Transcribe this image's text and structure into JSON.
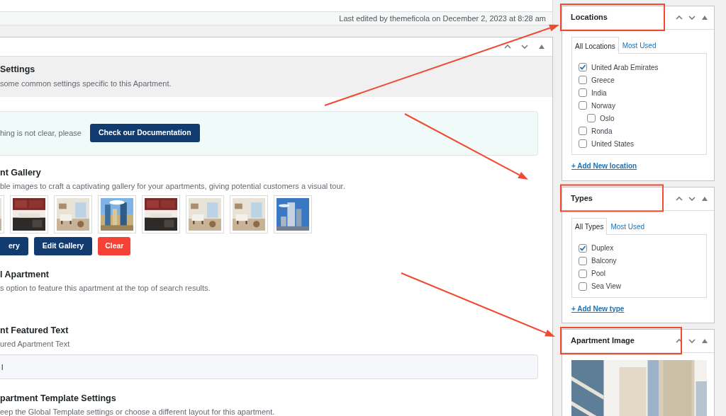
{
  "editor_status": {
    "last_edited": "Last edited by themeficola on December 2, 2023 at 8:28 am"
  },
  "settings_box": {
    "heading": "Settings",
    "description": "some common settings specific to this Apartment.",
    "notice": {
      "text": "hing is not clear, please",
      "button": "Check our Documentation"
    },
    "fields": [
      {
        "kind": "gallery",
        "label": "nt Gallery",
        "description": "ble images to craft a captivating gallery for your apartments, giving potential customers a visual tour.",
        "images": [
          {
            "kind": "picture"
          },
          {
            "kind": "picture"
          },
          {
            "kind": "picture"
          },
          {
            "kind": "picture"
          },
          {
            "kind": "picture"
          },
          {
            "kind": "picture"
          },
          {
            "kind": "picture"
          },
          {
            "kind": "picture"
          }
        ],
        "buttons": [
          {
            "label": "ery",
            "kind": "primary"
          },
          {
            "label": "Edit Gallery",
            "kind": "primary"
          },
          {
            "label": "Clear",
            "kind": "danger"
          }
        ]
      },
      {
        "kind": "option",
        "label": "l Apartment",
        "description": "s option to feature this apartment at the top of search results."
      },
      {
        "kind": "text",
        "label": "nt Featured Text",
        "description": "ured Apartment Text",
        "value": "l"
      },
      {
        "kind": "plain",
        "label": "partment Template Settings",
        "description": "eep the Global Template settings or choose a different layout for this apartment."
      }
    ]
  },
  "sidebar": [
    {
      "kind": "taxonomy",
      "title": "Locations",
      "tabs": [
        {
          "label": "All Locations",
          "selected": true
        },
        {
          "label": "Most Used",
          "selected": false
        }
      ],
      "terms": [
        {
          "label": "United Arab Emirates",
          "checked": true
        },
        {
          "label": "Greece",
          "checked": false
        },
        {
          "label": "India",
          "checked": false
        },
        {
          "label": "Norway",
          "checked": false,
          "children": [
            {
              "label": "Oslo",
              "checked": false
            }
          ]
        },
        {
          "label": "Ronda",
          "checked": false
        },
        {
          "label": "United States",
          "checked": false
        }
      ],
      "add_link": "+ Add New location"
    },
    {
      "kind": "taxonomy",
      "title": "Types",
      "tabs": [
        {
          "label": "All Types",
          "selected": true
        },
        {
          "label": "Most Used",
          "selected": false
        }
      ],
      "terms": [
        {
          "label": "Duplex",
          "checked": true
        },
        {
          "label": "Balcony",
          "checked": false
        },
        {
          "label": "Pool",
          "checked": false
        },
        {
          "label": "Sea View",
          "checked": false
        }
      ],
      "add_link": "+ Add New type"
    },
    {
      "title": "Apartment Image",
      "image": {
        "kind": "picture"
      }
    }
  ]
}
